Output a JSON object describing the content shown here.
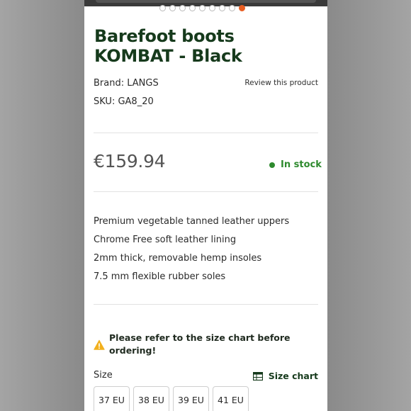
{
  "product": {
    "title_line1": "Barefoot boots",
    "title_line2": "KOMBAT - Black",
    "brand_label": "Brand:",
    "brand_value": "LANGS",
    "sku_label": "SKU:",
    "sku_value": "GA8_20",
    "review_link": "Review this product",
    "price": "€159.94",
    "stock_status": "In stock"
  },
  "gallery": {
    "total_images": 9,
    "active_index": 8
  },
  "features": [
    "Premium vegetable tanned leather uppers",
    "Chrome Free soft leather lining",
    "2mm thick, removable hemp insoles",
    "7.5 mm flexible rubber soles"
  ],
  "notice": {
    "icon": "warning-icon",
    "text": "Please refer to the size chart before ordering!"
  },
  "size_selector": {
    "label": "Size",
    "chart_link": "Size chart",
    "chart_icon": "table-icon",
    "sizes": [
      "37 EU",
      "38 EU",
      "39 EU",
      "41 EU"
    ]
  },
  "colors": {
    "title": "#163a1c",
    "in_stock": "#2e8a2e",
    "active_dot": "#e85d20",
    "warning": "#f2b01e"
  }
}
